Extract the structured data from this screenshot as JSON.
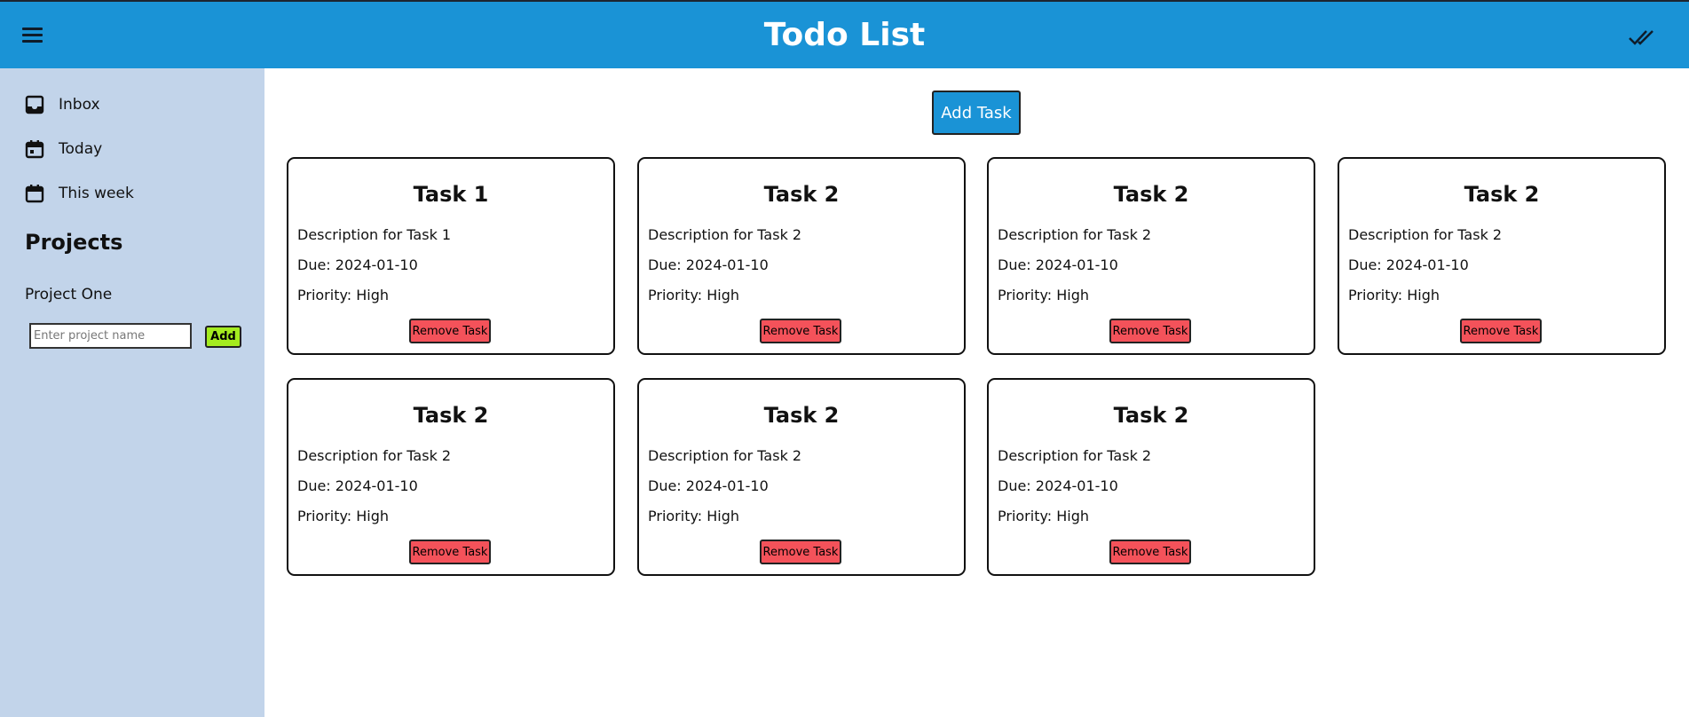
{
  "header": {
    "title": "Todo List",
    "menu_icon": "hamburger-menu-icon",
    "check_icon": "double-check-icon",
    "background": "#1a93d6"
  },
  "sidebar": {
    "nav": [
      {
        "label": "Inbox",
        "icon": "inbox-icon"
      },
      {
        "label": "Today",
        "icon": "calendar-icon"
      },
      {
        "label": "This week",
        "icon": "calendar-icon"
      }
    ],
    "projects_heading": "Projects",
    "projects": [
      "Project One"
    ],
    "project_input_placeholder": "Enter project name",
    "add_project_label": "Add",
    "background": "#c2d4ea"
  },
  "main": {
    "add_task_label": "Add Task",
    "tasks": [
      {
        "title": "Task 1",
        "description": "Description for Task 1",
        "due": "Due: 2024-01-10",
        "priority": "Priority: High",
        "remove_label": "Remove Task"
      },
      {
        "title": "Task 2",
        "description": "Description for Task 2",
        "due": "Due: 2024-01-10",
        "priority": "Priority: High",
        "remove_label": "Remove Task"
      },
      {
        "title": "Task 2",
        "description": "Description for Task 2",
        "due": "Due: 2024-01-10",
        "priority": "Priority: High",
        "remove_label": "Remove Task"
      },
      {
        "title": "Task 2",
        "description": "Description for Task 2",
        "due": "Due: 2024-01-10",
        "priority": "Priority: High",
        "remove_label": "Remove Task"
      },
      {
        "title": "Task 2",
        "description": "Description for Task 2",
        "due": "Due: 2024-01-10",
        "priority": "Priority: High",
        "remove_label": "Remove Task"
      },
      {
        "title": "Task 2",
        "description": "Description for Task 2",
        "due": "Due: 2024-01-10",
        "priority": "Priority: High",
        "remove_label": "Remove Task"
      },
      {
        "title": "Task 2",
        "description": "Description for Task 2",
        "due": "Due: 2024-01-10",
        "priority": "Priority: High",
        "remove_label": "Remove Task"
      }
    ],
    "remove_button_color": "#f4525a",
    "add_button_color": "#a4eb1f"
  }
}
